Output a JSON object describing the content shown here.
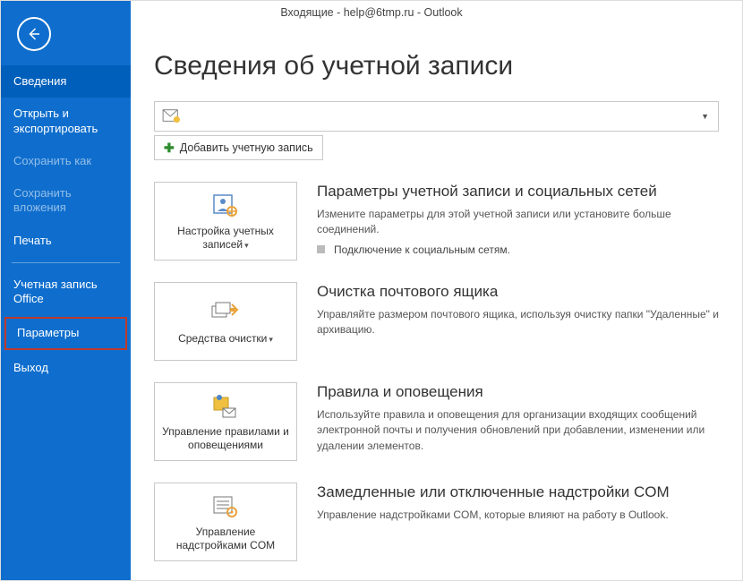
{
  "window_title": "Входящие - help@6tmp.ru - Outlook",
  "sidebar": {
    "items": [
      {
        "label": "Сведения",
        "active": true
      },
      {
        "label": "Открыть и экспортировать"
      },
      {
        "label": "Сохранить как",
        "dim": true
      },
      {
        "label": "Сохранить вложения",
        "dim": true
      },
      {
        "label": "Печать"
      },
      {
        "label": "Учетная запись Office"
      },
      {
        "label": "Параметры",
        "boxed": true
      },
      {
        "label": "Выход"
      }
    ]
  },
  "page": {
    "title": "Сведения об учетной записи",
    "add_account": "Добавить учетную запись"
  },
  "sections": {
    "account": {
      "tile": "Настройка учетных записей",
      "heading": "Параметры учетной записи и социальных сетей",
      "desc": "Измените параметры для этой учетной записи или установите больше соединений.",
      "sub": "Подключение к социальным сетям."
    },
    "cleanup": {
      "tile": "Средства очистки",
      "heading": "Очистка почтового ящика",
      "desc": "Управляйте размером почтового ящика, используя очистку папки \"Удаленные\" и архивацию."
    },
    "rules": {
      "tile": "Управление правилами и оповещениями",
      "heading": "Правила и оповещения",
      "desc": "Используйте правила и оповещения для организации входящих сообщений электронной почты и получения обновлений при добавлении, изменении или удалении элементов."
    },
    "com": {
      "tile": "Управление надстройками COM",
      "heading": "Замедленные или отключенные надстройки COM",
      "desc": "Управление надстройками COM, которые влияют на работу в Outlook."
    }
  }
}
